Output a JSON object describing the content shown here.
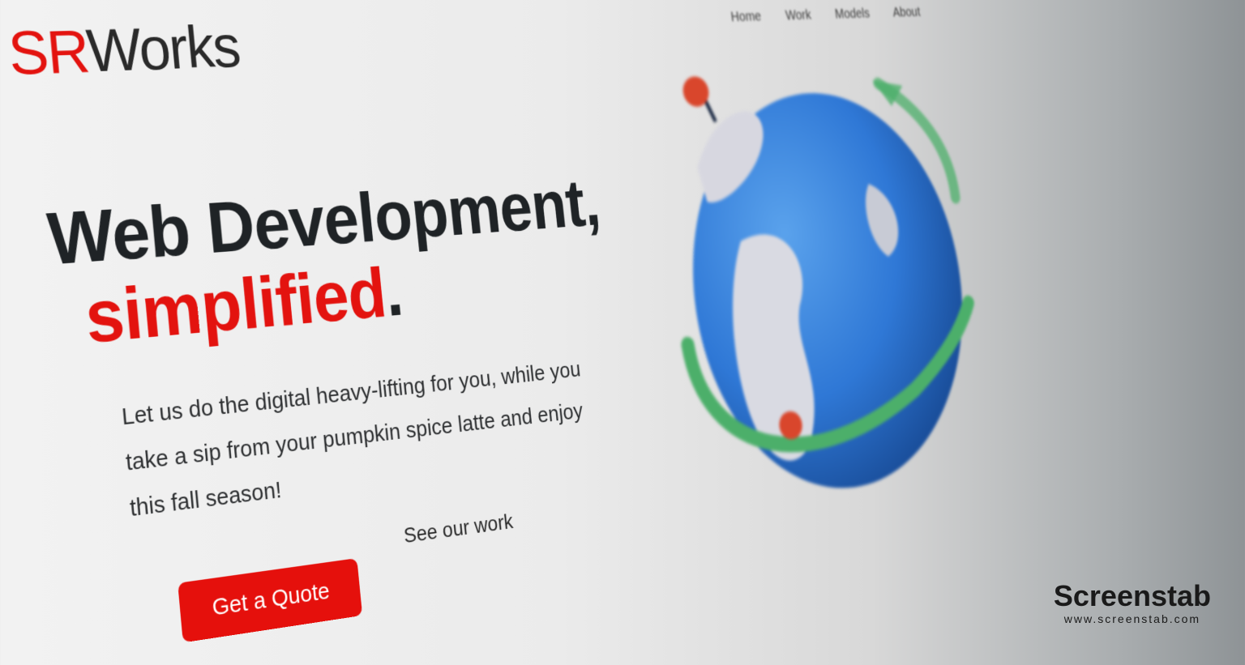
{
  "brand": {
    "logo_sr": "SR",
    "logo_works": "Works"
  },
  "nav": {
    "items": [
      "Home",
      "Work",
      "Models",
      "About"
    ]
  },
  "hero": {
    "headline_line1": "Web Development,",
    "headline_red": "simplified",
    "headline_dot": ".",
    "subtext": "Let us do the digital heavy-lifting for you, while you take a sip from your pumpkin spice latte and enjoy this fall season!",
    "cta_label": "Get a Quote",
    "secondary_link": "See our work"
  },
  "watermark": {
    "name": "Screenstab",
    "url": "www.screenstab.com"
  },
  "colors": {
    "brand_red": "#e3130f",
    "text_dark": "#1f2326",
    "globe_blue": "#2f78d6",
    "orbit_green": "#4caf6a"
  },
  "icons": {
    "globe": "globe-illustration-icon",
    "pin": "map-pin-icon"
  }
}
